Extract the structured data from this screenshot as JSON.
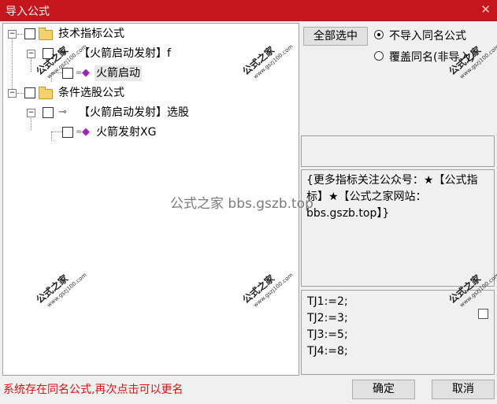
{
  "window": {
    "title": "导入公式",
    "close_glyph": "✕"
  },
  "tree": {
    "items": [
      {
        "label": "技术指标公式",
        "kind": "folder"
      },
      {
        "label": "【火箭启动发射】f",
        "kind": "key"
      },
      {
        "label": "火箭启动",
        "kind": "formula",
        "selected": true
      },
      {
        "label": "条件选股公式",
        "kind": "folder"
      },
      {
        "label": "【火箭启动发射】选股",
        "kind": "key"
      },
      {
        "label": "火箭发射XG",
        "kind": "formula"
      }
    ]
  },
  "options": {
    "select_all_label": "全部选中",
    "radio_skip_label": "不导入同名公式",
    "radio_overwrite_label": "覆盖同名(非导入)",
    "selected_radio": "skip"
  },
  "description": {
    "text": "{更多指标关注公众号：★【公式指标】★【公式之家网站：bbs.gszb.top】}"
  },
  "code": {
    "lines": [
      "TJ1:=2;",
      "TJ2:=3;",
      "TJ3:=5;",
      "TJ4:=8;"
    ]
  },
  "status": {
    "message": "系统存在同名公式,再次点击可以更名"
  },
  "buttons": {
    "ok_label": "确定",
    "cancel_label": "取消"
  },
  "watermarks": {
    "center_text": "公式之家 bbs.gszb.top",
    "stamp_text": "公式之家",
    "stamp_url": "www.gszj100.com"
  },
  "colors": {
    "title_bar": "#c4161c",
    "status_text": "#e01010",
    "formula_icon": "#a020c0"
  },
  "icons": {
    "folder": "folder-icon",
    "key": "key-icon",
    "formula": "formula-gem-icon"
  }
}
